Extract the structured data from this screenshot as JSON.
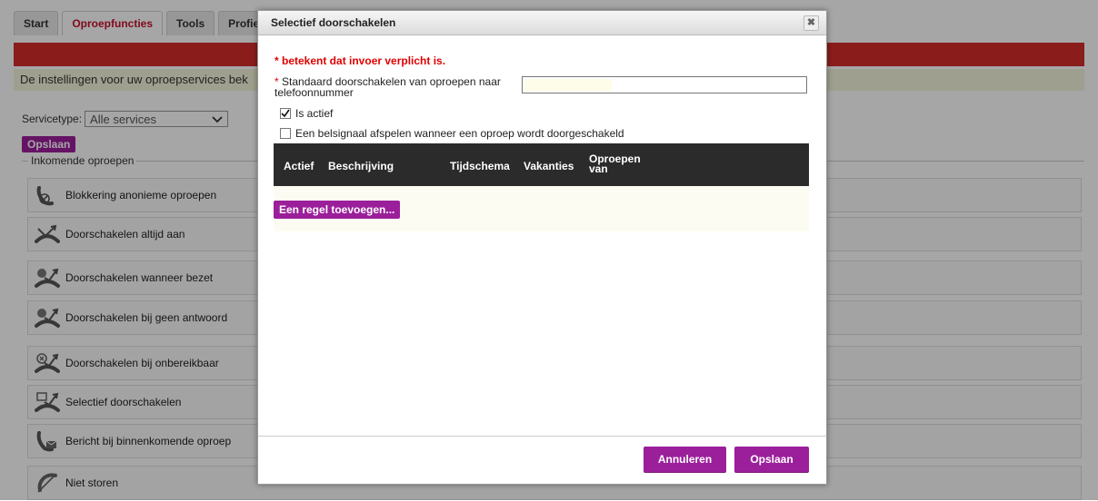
{
  "tabs": [
    "Start",
    "Oproepfuncties",
    "Tools",
    "Profiel"
  ],
  "info_text": "De instellingen voor uw oproepservices bek",
  "servicetype": {
    "label": "Servicetype:",
    "selected": "Alle services"
  },
  "save_small": "Opslaan",
  "incoming_legend": "Inkomende oproepen",
  "services": [
    {
      "label": "Blokkering anonieme oproepen",
      "icon": "blocked-call-icon"
    },
    {
      "label": "Doorschakelen altijd aan",
      "icon": "forward-always-icon"
    },
    {
      "label": "Doorschakelen wanneer bezet",
      "icon": "forward-busy-icon"
    },
    {
      "label": "Doorschakelen bij geen antwoord",
      "icon": "forward-no-answer-icon"
    },
    {
      "label": "Doorschakelen bij onbereikbaar",
      "icon": "forward-unreachable-icon"
    },
    {
      "label": "Selectief doorschakelen",
      "icon": "forward-selective-icon"
    },
    {
      "label": "Bericht bij binnenkomende oproep",
      "icon": "message-incoming-icon"
    },
    {
      "label": "Niet storen",
      "icon": "do-not-disturb-icon"
    }
  ],
  "dialog": {
    "title": "Selectief doorschakelen",
    "required_note": "* betekent dat invoer verplicht is.",
    "phone_label_star": "*",
    "phone_label": "Standaard doorschakelen van oproepen naar telefoonnummer",
    "phone_value": "",
    "is_active_label": "Is actief",
    "is_active_checked": true,
    "ring_label": "Een belsignaal afspelen wanneer een oproep wordt doorgeschakeld",
    "ring_checked": false,
    "table_headers": [
      "Actief",
      "Beschrijving",
      "Tijdschema",
      "Vakanties",
      "Oproepen van"
    ],
    "add_rule": "Een regel toevoegen...",
    "cancel": "Annuleren",
    "save": "Opslaan"
  },
  "colors": {
    "accent": "#9b1f9b",
    "red": "#d52b2b",
    "required": "#e00000"
  }
}
